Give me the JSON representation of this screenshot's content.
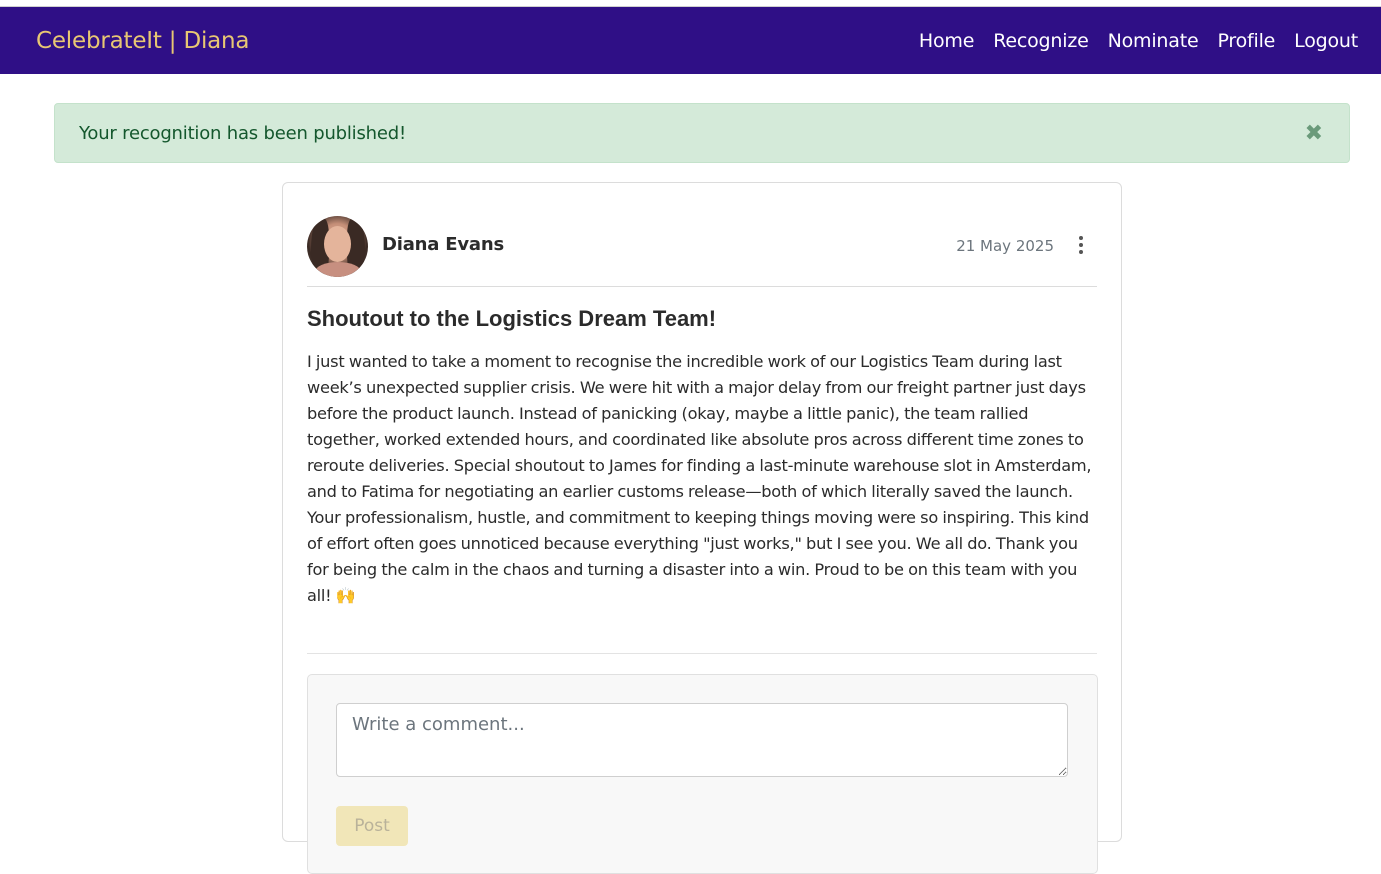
{
  "navbar": {
    "brand": "CelebrateIt | Diana",
    "links": [
      "Home",
      "Recognize",
      "Nominate",
      "Profile",
      "Logout"
    ]
  },
  "alert": {
    "message": "Your recognition has been published!",
    "close_glyph": "✖"
  },
  "post": {
    "author": "Diana Evans",
    "date": "21 May 2025",
    "title": "Shoutout to the Logistics Dream Team!",
    "body": "I just wanted to take a moment to recognise the incredible work of our Logistics Team during last week’s unexpected supplier crisis. We were hit with a major delay from our freight partner just days before the product launch. Instead of panicking (okay, maybe a little panic), the team rallied together, worked extended hours, and coordinated like absolute pros across different time zones to reroute deliveries. Special shoutout to James for finding a last-minute warehouse slot in Amsterdam, and to Fatima for negotiating an earlier customs release—both of which literally saved the launch. Your professionalism, hustle, and commitment to keeping things moving were so inspiring. This kind of effort often goes unnoticed because everything \"just works,\" but I see you. We all do. Thank you for being the calm in the chaos and turning a disaster into a win. Proud to be on this team with you all! 🙌"
  },
  "comment": {
    "placeholder": "Write a comment...",
    "post_label": "Post"
  },
  "icons": {
    "more": "more-vertical-icon",
    "close": "close-icon"
  },
  "colors": {
    "navbar_bg": "#2f0f86",
    "brand": "#e8c773",
    "alert_bg": "#d4ead9",
    "alert_text": "#14572d"
  }
}
